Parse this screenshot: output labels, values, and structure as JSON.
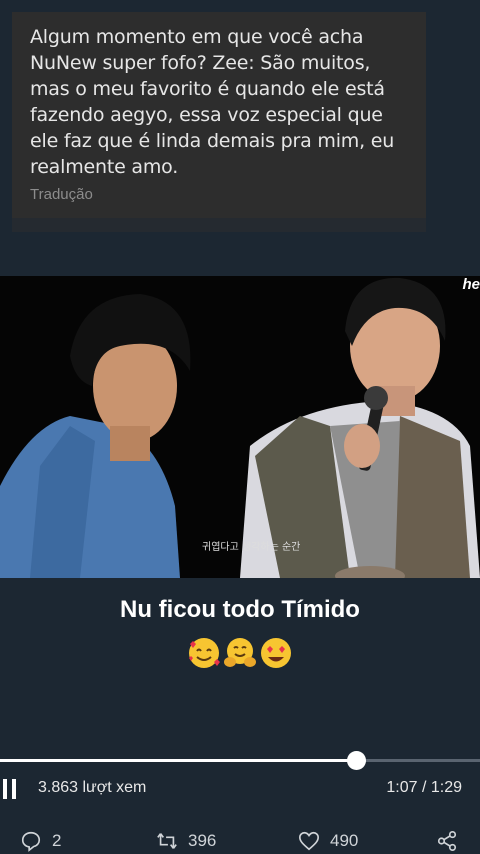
{
  "caption": {
    "text": "Algum momento em que você acha NuNew super fofo? Zee: São muitos, mas o meu favorito é quando ele está fazendo aegyo, essa voz especial que ele faz que é linda demais pra mim, eu realmente amo.",
    "translate_label": "Tradução"
  },
  "video": {
    "watermark": "he",
    "subtitle_kr": "귀엽다고 생각하는 순간"
  },
  "headline": "Nu ficou todo Tímido",
  "emojis": [
    "smiling-face-with-hearts",
    "hugging-face",
    "heart-eyes-face"
  ],
  "player": {
    "progress": 0.742,
    "views": "3.863 lượt xem",
    "time": "1:07 / 1:29"
  },
  "actions": {
    "comments": "2",
    "retweets": "396",
    "likes": "490"
  },
  "colors": {
    "background": "#1c2732",
    "card": "#2d2d2d",
    "track": "#5a6470"
  }
}
